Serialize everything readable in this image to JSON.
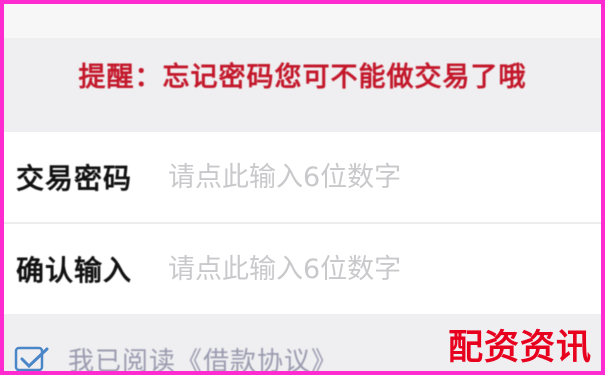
{
  "notice": "提醒：忘记密码您可不能做交易了哦",
  "form": {
    "trade_password": {
      "label": "交易密码",
      "placeholder": "请点此输入6位数字"
    },
    "confirm_input": {
      "label": "确认输入",
      "placeholder": "请点此输入6位数字"
    }
  },
  "agreement": {
    "text": "我已阅读《借款协议》"
  },
  "watermark": "配资资讯",
  "colors": {
    "notice": "#c3182b",
    "watermark": "#e8001f",
    "border": "#ff2bd0"
  }
}
